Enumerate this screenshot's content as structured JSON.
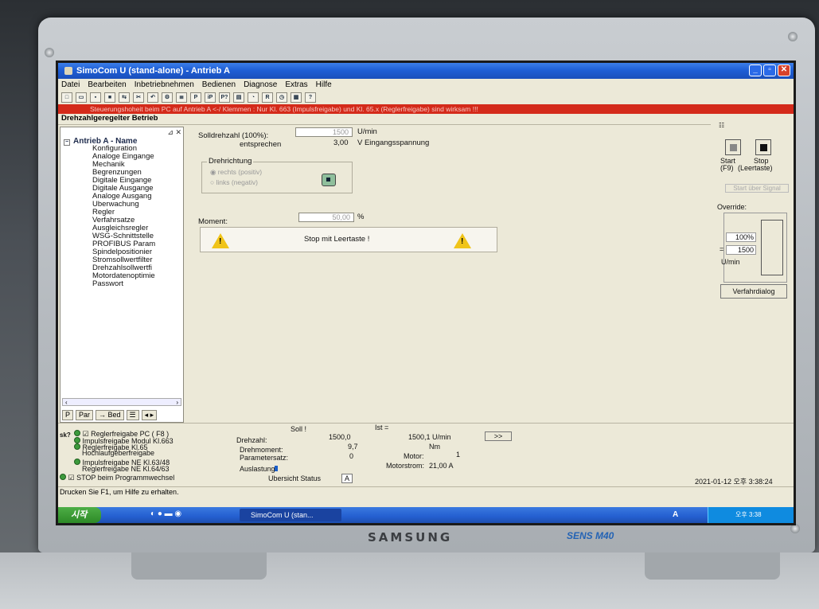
{
  "window": {
    "title": "SimoCom U (stand-alone) - Antrieb A"
  },
  "menu": [
    "Datei",
    "Bearbeiten",
    "Inbetriebnehmen",
    "Bedienen",
    "Diagnose",
    "Extras",
    "Hilfe"
  ],
  "toolbar": {
    "icons": [
      "new-file-icon",
      "open-folder-icon",
      "print-icon",
      "save-icon",
      "connect-icon",
      "tool-icon",
      "undo-icon",
      "settings-icon",
      "compare-icon",
      "parameter-icon",
      "ip-icon",
      "param-check-icon",
      "module-icon",
      "monitor-icon",
      "reset-icon",
      "clock-icon",
      "chart-icon",
      "help-icon"
    ]
  },
  "redbar": {
    "text": "Steuerungshoheit beim PC auf Antrieb A <-/ Klemmen : Nur Kl. 663 (Impulsfreigabe) und Kl. 65.x (Reglerfreigabe) sind wirksam !!!"
  },
  "mode": {
    "title": "Drehzahlgeregelter Betrieb"
  },
  "tree": {
    "root": "Antrieb A - Name",
    "items": [
      "Konfiguration",
      "Analoge Eingange",
      "Mechanik",
      "Begrenzungen",
      "Digitale Eingange",
      "Digitale Ausgange",
      "Analoge Ausgang",
      "Uberwachung",
      "Regler",
      "Verfahrsatze",
      "Ausgleichsregler",
      "WSG-Schnittstelle",
      "PROFIBUS Param",
      "Spindelpositionier",
      "Stromsollwertfilter",
      "Drehzahlsollwertfi",
      "Motordatenoptimie",
      "Passwort"
    ],
    "tabs": [
      "P",
      "Par",
      "→ Bed",
      "☰",
      "◂ ▸"
    ]
  },
  "main": {
    "setpoint_label": "Solldrehzahl (100%):",
    "setpoint_value": "1500",
    "setpoint_unit": "U/min",
    "corresponds_label": "entsprechen",
    "corresponds_value": "3,00",
    "corresponds_unit": "V Eingangsspannung",
    "direction_title": "Drehrichtung",
    "direction_right": "rechts (positiv)",
    "direction_left": "links (negativ)",
    "moment_label": "Moment:",
    "moment_value": "50,00",
    "moment_unit": "%",
    "stop_message": "Stop mit Leertaste !"
  },
  "right": {
    "start_label": "Start",
    "start_hint": "(F9)",
    "stop_label": "Stop",
    "stop_hint": "(Leertaste)",
    "start_signal": "Start über Signal",
    "override_label": "Override:",
    "override_percent": "100%",
    "override_rpm": "1500",
    "override_unit": "U/min",
    "verfahr_button": "Verfahrdialog"
  },
  "status": {
    "reglerfreigabe_pc": "Reglerfreigabe PC  ( F8 )",
    "impulsfreigabe_modul": "Impulsfreigabe Modul Kl.663",
    "reglerfreigabe_kl65": "Reglerfreigabe Kl.65",
    "hochlauf": "Hochlaufgeberfreigabe",
    "impuls_ne": "Impulsfreigabe NE Kl.63/48",
    "regler_ne": "Reglerfreigabe NE Kl.64/63",
    "stop_prog": "STOP beim Programmwechsel",
    "soll_header": "Soll !",
    "ist_header": "Ist =",
    "drehzahl_label": "Drehzahl:",
    "drehzahl_soll": "1500,0",
    "drehzahl_ist": "1500,1 U/min",
    "drehmoment_label": "Drehmoment:",
    "drehmoment_soll": "9,7",
    "drehmoment_unit": "Nm",
    "paramsatz_label": "Parametersatz:",
    "paramsatz_value": "0",
    "motor_label": "Motor:",
    "motor_value": "1",
    "auslastung_label": "Auslastung:",
    "motorstrom_label": "Motorstrom:",
    "motorstrom_value": "21,00 A",
    "more_button": ">>",
    "uebersicht_label": "Ubersicht Status",
    "uebersicht_value": "A",
    "datetime": "2021-01-12 오후 3:38:24"
  },
  "helpline": "Drucken Sie F1, um Hilfe zu erhalten.",
  "taskbar": {
    "start": "시작",
    "app": "SimoCom U (stan...",
    "lang": "A",
    "clock": "오후 3:38"
  },
  "device": {
    "brand": "SAMSUNG",
    "model": "SENS M40"
  }
}
